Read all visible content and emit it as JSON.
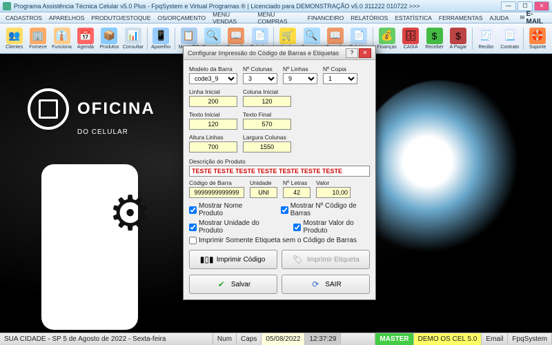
{
  "titlebar": "Programa Assistência Técnica Celular v5.0 Plus - FpqSystem e Virtual Programas ® | Licenciado para  DEMONSTRAÇÃO v5.0 311222 010722 >>>",
  "menubar": [
    "CADASTROS",
    "APARELHOS",
    "PRODUTO/ESTOQUE",
    "OS/ORÇAMENTO",
    "MENU VENDAS",
    "MENU COMPRAS",
    "FINANCEIRO",
    "RELATÓRIOS",
    "ESTATÍSTICA",
    "FERRAMENTAS",
    "AJUDA"
  ],
  "email_label": "E-MAIL",
  "toolbar": [
    {
      "label": "Clientes",
      "icon": "👥",
      "bg": "#fd6"
    },
    {
      "label": "Fornece",
      "icon": "🏢",
      "bg": "#fa6"
    },
    {
      "label": "Funciona",
      "icon": "👔",
      "bg": "#fc8"
    },
    {
      "label": "Agenda",
      "icon": "📅",
      "bg": "#f66"
    },
    {
      "label": "Produtos",
      "icon": "📦",
      "bg": "#8cf"
    },
    {
      "label": "Consultar",
      "icon": "📊",
      "bg": "#cde"
    },
    {
      "sep": true
    },
    {
      "label": "Aparelho",
      "icon": "📱",
      "bg": "#9cf"
    },
    {
      "sep": true
    },
    {
      "label": "Menu OS",
      "icon": "📋",
      "bg": "#ace"
    },
    {
      "label": "Pesquisa",
      "icon": "🔍",
      "bg": "#adf"
    },
    {
      "label": "Consulta",
      "icon": "📖",
      "bg": "#e96"
    },
    {
      "label": "Relatório",
      "icon": "📄",
      "bg": "#bdf"
    },
    {
      "sep": true
    },
    {
      "label": "Vendas",
      "icon": "🛒",
      "bg": "#fd4"
    },
    {
      "label": "Pesquisa",
      "icon": "🔍",
      "bg": "#adf"
    },
    {
      "label": "Consulta",
      "icon": "📖",
      "bg": "#e96"
    },
    {
      "label": "Relatório",
      "icon": "📄",
      "bg": "#bdf"
    },
    {
      "sep": true
    },
    {
      "label": "Finanças",
      "icon": "💰",
      "bg": "#6c6"
    },
    {
      "label": "CAIXA",
      "icon": "🗄",
      "bg": "#d44"
    },
    {
      "label": "Receber",
      "icon": "$",
      "bg": "#4b4"
    },
    {
      "label": "A Pagar",
      "icon": "$",
      "bg": "#b44"
    },
    {
      "sep": true
    },
    {
      "label": "Recibo",
      "icon": "🧾",
      "bg": "#eef"
    },
    {
      "label": "Contrato",
      "icon": "📃",
      "bg": "#eef"
    },
    {
      "sep": true
    },
    {
      "label": "Suporte",
      "icon": "🛟",
      "bg": "#f84"
    }
  ],
  "brand": {
    "name": "OFICINA",
    "sub": "DO CELULAR"
  },
  "dialog": {
    "title": "Configurar Impressão do Código de Barras e Etiquetas",
    "modelo_barra_label": "Modelo da Barra",
    "modelo_barra_value": "code3_9",
    "n_colunas_label": "Nº Colunas",
    "n_colunas_value": "3",
    "n_linhas_label": "Nº Linhas",
    "n_linhas_value": "9",
    "n_copia_label": "Nº Copia",
    "n_copia_value": "1",
    "linha_inicial_label": "Linha Inicial",
    "linha_inicial_value": "200",
    "coluna_inicial_label": "Coluna Inicial",
    "coluna_inicial_value": "120",
    "texto_inicial_label": "Texto Inicial",
    "texto_inicial_value": "120",
    "texto_final_label": "Texto Final",
    "texto_final_value": "570",
    "altura_linhas_label": "Altura Linhas",
    "altura_linhas_value": "700",
    "largura_colunas_label": "Largura Colunas",
    "largura_colunas_value": "1550",
    "descricao_label": "Descrição do Produto",
    "descricao_value": "TESTE TESTE TESTE TESTE TESTE TESTE TESTE",
    "codigo_barra_label": "Código de Barra",
    "codigo_barra_value": "9999999999999",
    "unidade_label": "Unidade",
    "unidade_value": "UNI",
    "n_letras_label": "Nº Letras",
    "n_letras_value": "42",
    "valor_label": "Valor",
    "valor_value": "10,00",
    "chk_nome": "Mostrar Nome Produto",
    "chk_codigo": "Mostrar Nº Código de Barras",
    "chk_unidade": "Mostrar Unidade do Produto",
    "chk_valor": "Mostrar Valor do Produto",
    "chk_somente": "Imprimir Somente Etiqueta sem o Código de Barras",
    "btn_imprimir_codigo": "Imprimir Código",
    "btn_imprimir_etiqueta": "Imprimir Etiqueta",
    "btn_salvar": "Salvar",
    "btn_sair": "SAIR"
  },
  "statusbar": {
    "location": "SUA CIDADE - SP  5 de Agosto de 2022 - Sexta-feira",
    "num": "Num",
    "caps": "Caps",
    "date1": "05/08/2022",
    "time": "12:37:29",
    "master": "MASTER",
    "demo": "DEMO OS CEL 5.0",
    "email": "Email",
    "sys": "FpqSystem"
  }
}
